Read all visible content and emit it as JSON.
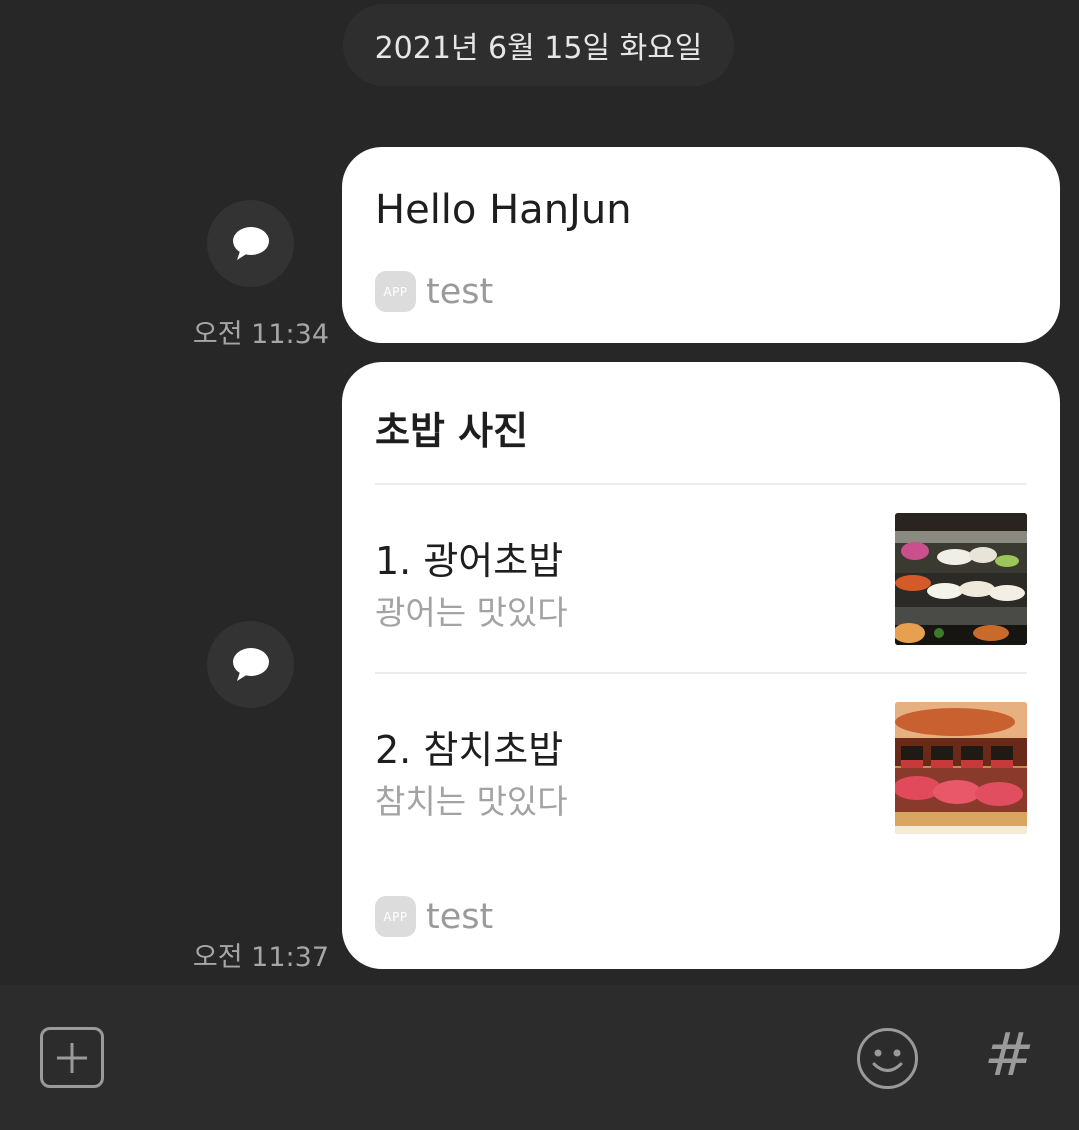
{
  "date_divider": "2021년 6월 15일 화요일",
  "messages": [
    {
      "type": "text",
      "text": "Hello HanJun",
      "app_badge": "APP",
      "app_name": "test",
      "time": "오전 11:34"
    },
    {
      "type": "list",
      "title": "초밥 사진",
      "items": [
        {
          "title": "1. 광어초밥",
          "description": "광어는 맛있다",
          "image": "flatfish-sushi-photo"
        },
        {
          "title": "2. 참치초밥",
          "description": "참치는 맛있다",
          "image": "tuna-sushi-photo"
        }
      ],
      "app_badge": "APP",
      "app_name": "test",
      "time": "오전 11:37"
    }
  ],
  "composer": {
    "add_icon": "plus-square-icon",
    "emoji_icon": "smiley-icon",
    "hashtag_icon": "#"
  },
  "colors": {
    "background": "#272727",
    "bubble": "#ffffff",
    "muted_text": "#a6a6a6"
  }
}
